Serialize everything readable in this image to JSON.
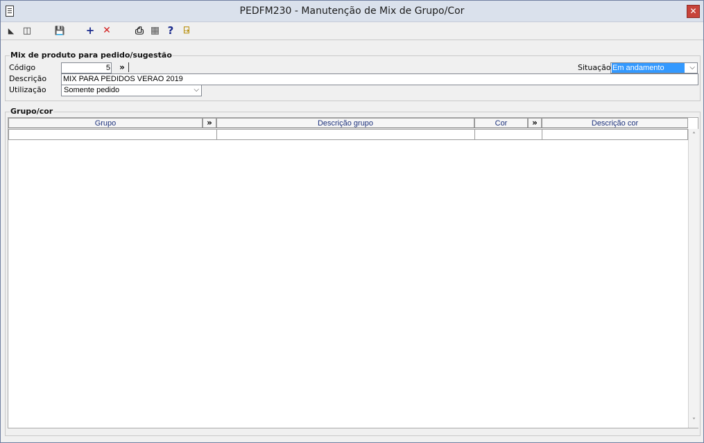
{
  "window": {
    "title": "PEDFM230 - Manutenção de Mix de Grupo/Cor",
    "close_glyph": "✕"
  },
  "toolbar": {
    "buttons": [
      {
        "name": "first-record-icon",
        "glyph": "◣"
      },
      {
        "name": "copy-records-icon",
        "glyph": "◫"
      },
      {
        "name": "save-icon",
        "glyph": "💾"
      },
      {
        "name": "add-icon",
        "glyph": "+"
      },
      {
        "name": "delete-icon",
        "glyph": "✕"
      },
      {
        "name": "print-icon",
        "glyph": "⎙"
      },
      {
        "name": "calculator-icon",
        "glyph": "▦"
      },
      {
        "name": "help-icon",
        "glyph": "?"
      },
      {
        "name": "exit-door-icon",
        "glyph": "⍈"
      }
    ]
  },
  "mix": {
    "section_title": "Mix de produto para pedido/sugestão",
    "codigo_label": "Código",
    "codigo_value": "5",
    "lookup_glyph": "»",
    "situacao_label": "Situação",
    "situacao_value": "Em andamento",
    "descricao_label": "Descrição",
    "descricao_value": "MIX PARA PEDIDOS VERAO 2019",
    "utilizacao_label": "Utilização",
    "utilizacao_value": "Somente pedido"
  },
  "grid": {
    "section_title": "Grupo/cor",
    "columns": [
      "Grupo",
      "Descrição grupo",
      "Cor",
      "Descrição cor"
    ],
    "lookup_glyph": "»",
    "scroll_up": "˄",
    "scroll_down": "˅"
  },
  "colors": {
    "accent": "#1a2f7a",
    "selection": "#3399ff",
    "close": "#c7433a"
  }
}
